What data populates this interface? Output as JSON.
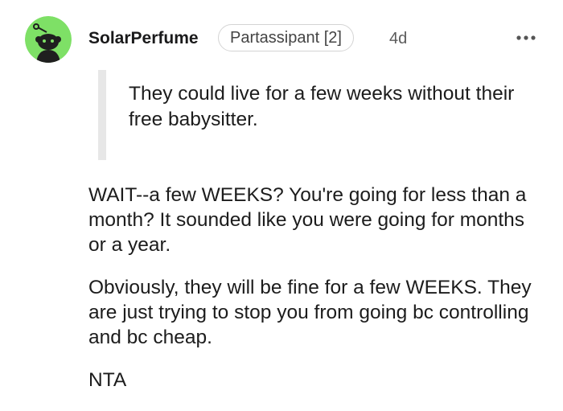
{
  "comment": {
    "author": "SolarPerfume",
    "flair": "Partassipant [2]",
    "timestamp": "4d",
    "avatar_icon": "reddit-snoo-avatar-icon",
    "more_icon": "more-options-icon",
    "quote": "They could live for a few weeks without their free babysitter.",
    "paragraphs": [
      "WAIT--a few WEEKS? You're going for less than a month? It sounded like you were going for months or a year.",
      "Obviously, they will be fine for a few WEEKS. They are just trying to stop you from going bc controlling and bc cheap.",
      "NTA"
    ]
  },
  "colors": {
    "avatar_bg": "#7ee066",
    "avatar_figure": "#1f1f1f",
    "quote_bar": "#e7e7e7",
    "text": "#1c1c1c",
    "meta": "#5a5a5a"
  }
}
